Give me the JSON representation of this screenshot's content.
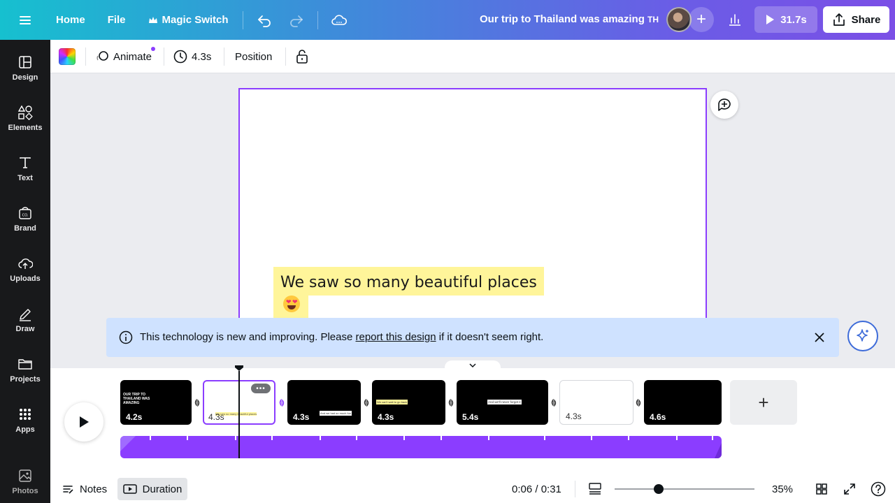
{
  "topbar": {
    "home_label": "Home",
    "file_label": "File",
    "magic_switch_label": "Magic Switch",
    "doc_title": "Our trip to Thailand was amazing",
    "doc_title_suffix": "TH",
    "play_duration": "31.7s",
    "share_label": "Share"
  },
  "sidebar": {
    "items": [
      {
        "label": "Design",
        "icon": "layout-icon"
      },
      {
        "label": "Elements",
        "icon": "shapes-icon"
      },
      {
        "label": "Text",
        "icon": "text-icon"
      },
      {
        "label": "Brand",
        "icon": "brand-icon"
      },
      {
        "label": "Uploads",
        "icon": "cloud-upload-icon"
      },
      {
        "label": "Draw",
        "icon": "pen-icon"
      },
      {
        "label": "Projects",
        "icon": "folder-icon"
      },
      {
        "label": "Apps",
        "icon": "grid-icon"
      },
      {
        "label": "Photos",
        "icon": "image-icon"
      }
    ]
  },
  "toolbar": {
    "animate_label": "Animate",
    "duration_label": "4.3s",
    "position_label": "Position"
  },
  "canvas": {
    "caption_text": "We saw so many beautiful places",
    "caption_emoji": "heart-eyes-emoji"
  },
  "banner": {
    "text_before": "This technology is new and improving. Please ",
    "link_text": "report this design",
    "text_after": " if it doesn't seem right."
  },
  "timeline": {
    "clips": [
      {
        "duration": "4.2s",
        "theme": "dark",
        "preview_text": "OUR TRIP TO THAILAND WAS AMAZING"
      },
      {
        "duration": "4.3s",
        "theme": "light",
        "preview_text": "We saw so many beautiful places",
        "selected": true
      },
      {
        "duration": "4.3s",
        "theme": "dark",
        "preview_text": "And we had so much fun"
      },
      {
        "duration": "4.3s",
        "theme": "dark",
        "preview_text": "We can't wait to go back"
      },
      {
        "duration": "5.4s",
        "theme": "dark",
        "preview_text": "And we'll never forget it"
      },
      {
        "duration": "4.3s",
        "theme": "light",
        "preview_text": ""
      },
      {
        "duration": "4.6s",
        "theme": "dark",
        "preview_text": ""
      }
    ],
    "more_chip": "•••"
  },
  "bottombar": {
    "notes_label": "Notes",
    "duration_label": "Duration",
    "time_readout": "0:06 / 0:31",
    "zoom_percent": "35%",
    "zoom_level": 0.35
  },
  "colors": {
    "accent": "#8b3dff",
    "banner_bg": "#cfe2ff",
    "caption_highlight": "#fff59a",
    "sidebar_bg": "#18191b"
  }
}
